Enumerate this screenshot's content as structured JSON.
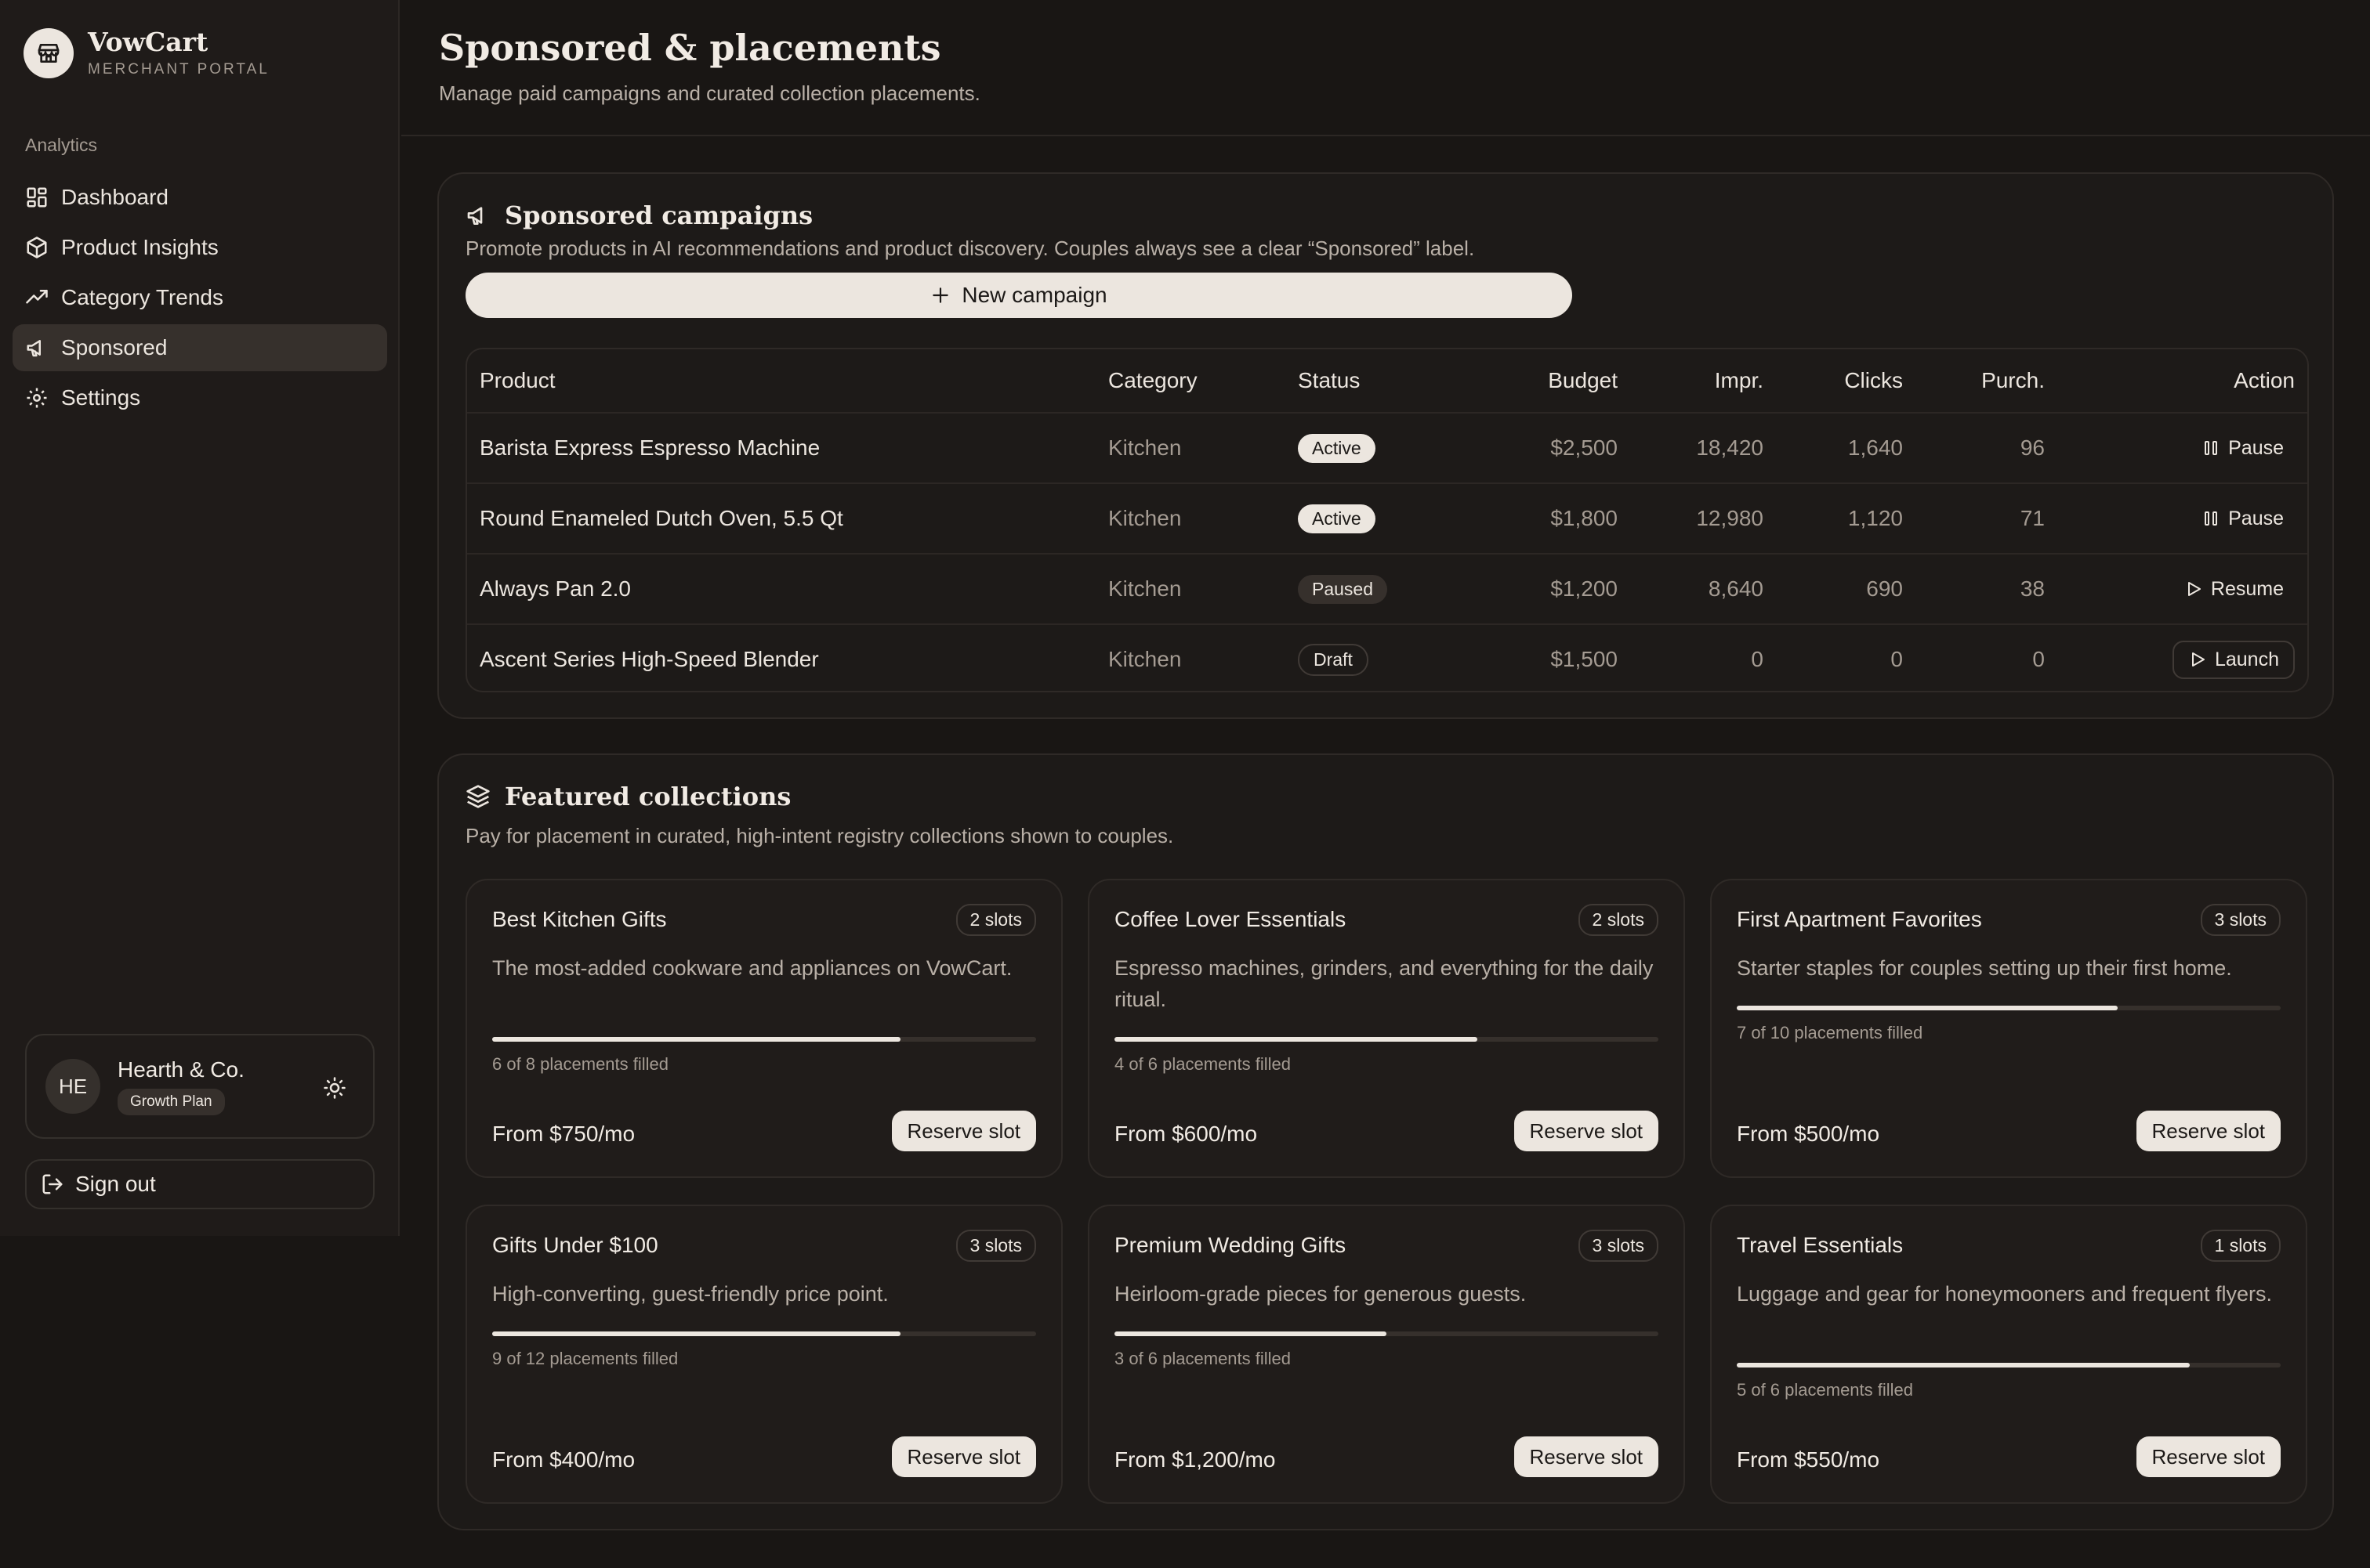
{
  "brand": {
    "name": "VowCart",
    "subtitle": "MERCHANT PORTAL"
  },
  "sidebar": {
    "section": "Analytics",
    "items": [
      {
        "label": "Dashboard",
        "icon": "grid-icon",
        "active": false
      },
      {
        "label": "Product Insights",
        "icon": "box-icon",
        "active": false
      },
      {
        "label": "Category Trends",
        "icon": "trend-icon",
        "active": false
      },
      {
        "label": "Sponsored",
        "icon": "megaphone-icon",
        "active": true
      },
      {
        "label": "Settings",
        "icon": "gear-icon",
        "active": false
      }
    ],
    "account": {
      "initials": "HE",
      "name": "Hearth & Co.",
      "plan": "Growth Plan"
    },
    "signout": "Sign out"
  },
  "header": {
    "title": "Sponsored & placements",
    "subtitle": "Manage paid campaigns and curated collection placements."
  },
  "campaigns": {
    "title": "Sponsored campaigns",
    "description": "Promote products in AI recommendations and product discovery. Couples always see a clear “Sponsored” label.",
    "new_button": "New campaign",
    "columns": {
      "product": "Product",
      "category": "Category",
      "status": "Status",
      "budget": "Budget",
      "impr": "Impr.",
      "clicks": "Clicks",
      "purch": "Purch.",
      "action": "Action"
    },
    "rows": [
      {
        "product": "Barista Express Espresso Machine",
        "category": "Kitchen",
        "status": "Active",
        "budget": "$2,500",
        "impr": "18,420",
        "clicks": "1,640",
        "purch": "96",
        "action": "Pause"
      },
      {
        "product": "Round Enameled Dutch Oven, 5.5 Qt",
        "category": "Kitchen",
        "status": "Active",
        "budget": "$1,800",
        "impr": "12,980",
        "clicks": "1,120",
        "purch": "71",
        "action": "Pause"
      },
      {
        "product": "Always Pan 2.0",
        "category": "Kitchen",
        "status": "Paused",
        "budget": "$1,200",
        "impr": "8,640",
        "clicks": "690",
        "purch": "38",
        "action": "Resume"
      },
      {
        "product": "Ascent Series High-Speed Blender",
        "category": "Kitchen",
        "status": "Draft",
        "budget": "$1,500",
        "impr": "0",
        "clicks": "0",
        "purch": "0",
        "action": "Launch"
      }
    ]
  },
  "collections": {
    "title": "Featured collections",
    "description": "Pay for placement in curated, high-intent registry collections shown to couples.",
    "reserve_label": "Reserve slot",
    "cards": [
      {
        "title": "Best Kitchen Gifts",
        "slots": "2 slots",
        "description": "The most-added cookware and appliances on VowCart.",
        "filled": 6,
        "total": 8,
        "fill_text": "6 of 8 placements filled",
        "price": "From $750/mo"
      },
      {
        "title": "Coffee Lover Essentials",
        "slots": "2 slots",
        "description": "Espresso machines, grinders, and everything for the daily ritual.",
        "filled": 4,
        "total": 6,
        "fill_text": "4 of 6 placements filled",
        "price": "From $600/mo"
      },
      {
        "title": "First Apartment Favorites",
        "slots": "3 slots",
        "description": "Starter staples for couples setting up their first home.",
        "filled": 7,
        "total": 10,
        "fill_text": "7 of 10 placements filled",
        "price": "From $500/mo"
      },
      {
        "title": "Gifts Under $100",
        "slots": "3 slots",
        "description": "High-converting, guest-friendly price point.",
        "filled": 9,
        "total": 12,
        "fill_text": "9 of 12 placements filled",
        "price": "From $400/mo"
      },
      {
        "title": "Premium Wedding Gifts",
        "slots": "3 slots",
        "description": "Heirloom-grade pieces for generous guests.",
        "filled": 3,
        "total": 6,
        "fill_text": "3 of 6 placements filled",
        "price": "From $1,200/mo"
      },
      {
        "title": "Travel Essentials",
        "slots": "1 slots",
        "description": "Luggage and gear for honeymooners and frequent flyers.",
        "filled": 5,
        "total": 6,
        "fill_text": "5 of 6 placements filled",
        "price": "From $550/mo"
      }
    ]
  }
}
